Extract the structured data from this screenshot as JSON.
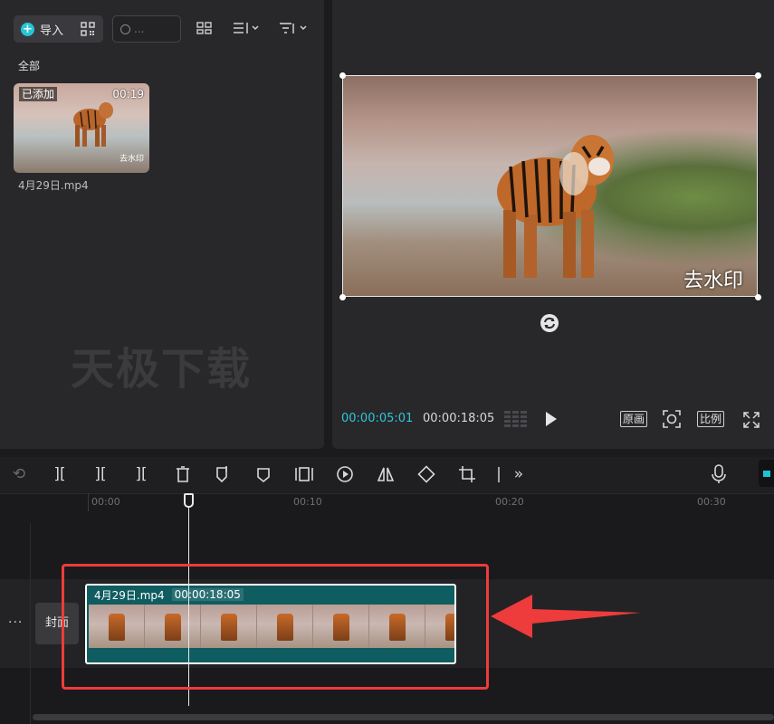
{
  "media": {
    "import_label": "导入",
    "search_placeholder": "...",
    "section_label": "全部",
    "item": {
      "badge": "已添加",
      "duration": "00:19",
      "filename": "4月29日.mp4",
      "thumb_watermark": "去水印"
    },
    "panel_watermark": "天极下载"
  },
  "preview": {
    "video_watermark": "去水印",
    "current_time": "00:00:05:01",
    "total_time": "00:00:18:05",
    "btn_original": "原画",
    "btn_ratio": "比例"
  },
  "timeline": {
    "ruler": [
      "00:00",
      "00:10",
      "00:20",
      "00:30"
    ],
    "cover_label": "封面",
    "track_more": "···",
    "clip": {
      "name": "4月29日.mp4",
      "duration": "00:00:18:05",
      "frame_count": 7
    }
  },
  "colors": {
    "accent": "#2fc7d8",
    "clip": "#0f5d61",
    "highlight": "#ee3b3b"
  }
}
